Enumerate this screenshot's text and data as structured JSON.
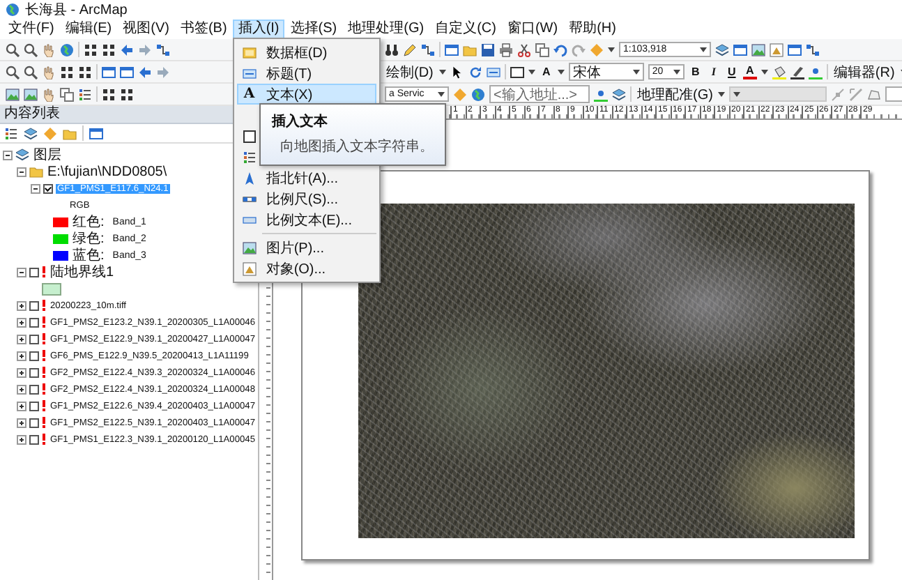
{
  "window": {
    "title": "长海县 - ArcMap"
  },
  "menu_bar": [
    {
      "label": "文件(F)",
      "selected": false
    },
    {
      "label": "编辑(E)",
      "selected": false
    },
    {
      "label": "视图(V)",
      "selected": false
    },
    {
      "label": "书签(B)",
      "selected": false
    },
    {
      "label": "插入(I)",
      "selected": true
    },
    {
      "label": "选择(S)",
      "selected": false
    },
    {
      "label": "地理处理(G)",
      "selected": false
    },
    {
      "label": "自定义(C)",
      "selected": false
    },
    {
      "label": "窗口(W)",
      "selected": false
    },
    {
      "label": "帮助(H)",
      "selected": false
    }
  ],
  "insert_menu": [
    {
      "kind": "item",
      "label": "数据框(D)",
      "selected": false
    },
    {
      "kind": "item",
      "label": "标题(T)",
      "selected": false
    },
    {
      "kind": "item",
      "glyph": "A",
      "label": "文本(X)",
      "selected": true
    },
    {
      "kind": "item",
      "selected": false
    },
    {
      "kind": "item",
      "selected": false
    },
    {
      "kind": "item",
      "selected": false
    },
    {
      "kind": "item",
      "label": "指北针(A)...",
      "selected": false
    },
    {
      "kind": "item",
      "label": "比例尺(S)...",
      "selected": false
    },
    {
      "kind": "item",
      "label": "比例文本(E)...",
      "selected": false
    },
    {
      "kind": "separator"
    },
    {
      "kind": "item",
      "label": "图片(P)...",
      "selected": false
    },
    {
      "kind": "item",
      "label": "对象(O)...",
      "selected": false
    }
  ],
  "tooltip": {
    "title": "插入文本",
    "text": "向地图插入文本字符串。"
  },
  "toolbars": {
    "scale": "1:103,918",
    "drawing_menu": "绘制(D)",
    "text_tool": "A",
    "font": "宋体",
    "font_size": "20",
    "bold": "B",
    "italic": "I",
    "underline": "U",
    "font_color": "A",
    "editor_menu": "编辑器(R)",
    "service_field": "a Servic",
    "address_placeholder": "<输入地址...>",
    "georef_menu": "地理配准(G)"
  },
  "toc": {
    "title": "内容列表",
    "tree": [
      {
        "kind": "group",
        "label": "图层",
        "expanded": true,
        "children": [
          {
            "kind": "folder",
            "label": "E:\\fujian\\NDD0805\\",
            "expanded": true,
            "children": [
              {
                "kind": "raster_layer",
                "label": "GF1_PMS1_E117.6_N24.1",
                "expanded": true,
                "checked": true,
                "selected": true,
                "children": [
                  {
                    "kind": "heading",
                    "label": "RGB"
                  },
                  {
                    "kind": "band",
                    "label": "红色:",
                    "value": "Band_1",
                    "color": "#ff0000"
                  },
                  {
                    "kind": "band",
                    "label": "绿色:",
                    "value": "Band_2",
                    "color": "#00dd00"
                  },
                  {
                    "kind": "band",
                    "label": "蓝色:",
                    "value": "Band_3",
                    "color": "#0000ff"
                  }
                ]
              }
            ]
          },
          {
            "kind": "feature_layer",
            "label": "陆地界线1",
            "expanded": true,
            "checked": false,
            "selected": false,
            "missing_source": true,
            "children": [
              {
                "kind": "swatch",
                "color": "#c6efce"
              }
            ]
          },
          {
            "kind": "raster_layer",
            "label": "20200223_10m.tiff",
            "expanded": false,
            "checked": false,
            "selected": false,
            "missing_source": true
          },
          {
            "kind": "raster_layer",
            "label": "GF1_PMS2_E123.2_N39.1_20200305_L1A00046",
            "expanded": false,
            "checked": false,
            "selected": false,
            "missing_source": true
          },
          {
            "kind": "raster_layer",
            "label": "GF1_PMS2_E122.9_N39.1_20200427_L1A00047",
            "expanded": false,
            "checked": false,
            "selected": false,
            "missing_source": true
          },
          {
            "kind": "raster_layer",
            "label": "GF6_PMS_E122.9_N39.5_20200413_L1A11199",
            "expanded": false,
            "checked": false,
            "selected": false,
            "missing_source": true
          },
          {
            "kind": "raster_layer",
            "label": "GF2_PMS2_E122.4_N39.3_20200324_L1A00046",
            "expanded": false,
            "checked": false,
            "selected": false,
            "missing_source": true
          },
          {
            "kind": "raster_layer",
            "label": "GF2_PMS2_E122.4_N39.1_20200324_L1A00048",
            "expanded": false,
            "checked": false,
            "selected": false,
            "missing_source": true
          },
          {
            "kind": "raster_layer",
            "label": "GF1_PMS2_E122.6_N39.4_20200403_L1A00047",
            "expanded": false,
            "checked": false,
            "selected": false,
            "missing_source": true
          },
          {
            "kind": "raster_layer",
            "label": "GF1_PMS2_E122.5_N39.1_20200403_L1A00047",
            "expanded": false,
            "checked": false,
            "selected": false,
            "missing_source": true
          },
          {
            "kind": "raster_layer",
            "label": "GF1_PMS1_E122.3_N39.1_20200120_L1A00045",
            "expanded": false,
            "checked": false,
            "selected": false,
            "missing_source": true
          }
        ]
      }
    ]
  },
  "ruler": {
    "labels": [
      "1",
      "2",
      "3",
      "4",
      "5",
      "6",
      "7",
      "8",
      "9",
      "10",
      "11",
      "12",
      "13",
      "14",
      "15",
      "16",
      "17",
      "18",
      "19",
      "20",
      "21",
      "22",
      "23",
      "24",
      "25",
      "26",
      "27",
      "28",
      "29"
    ]
  }
}
